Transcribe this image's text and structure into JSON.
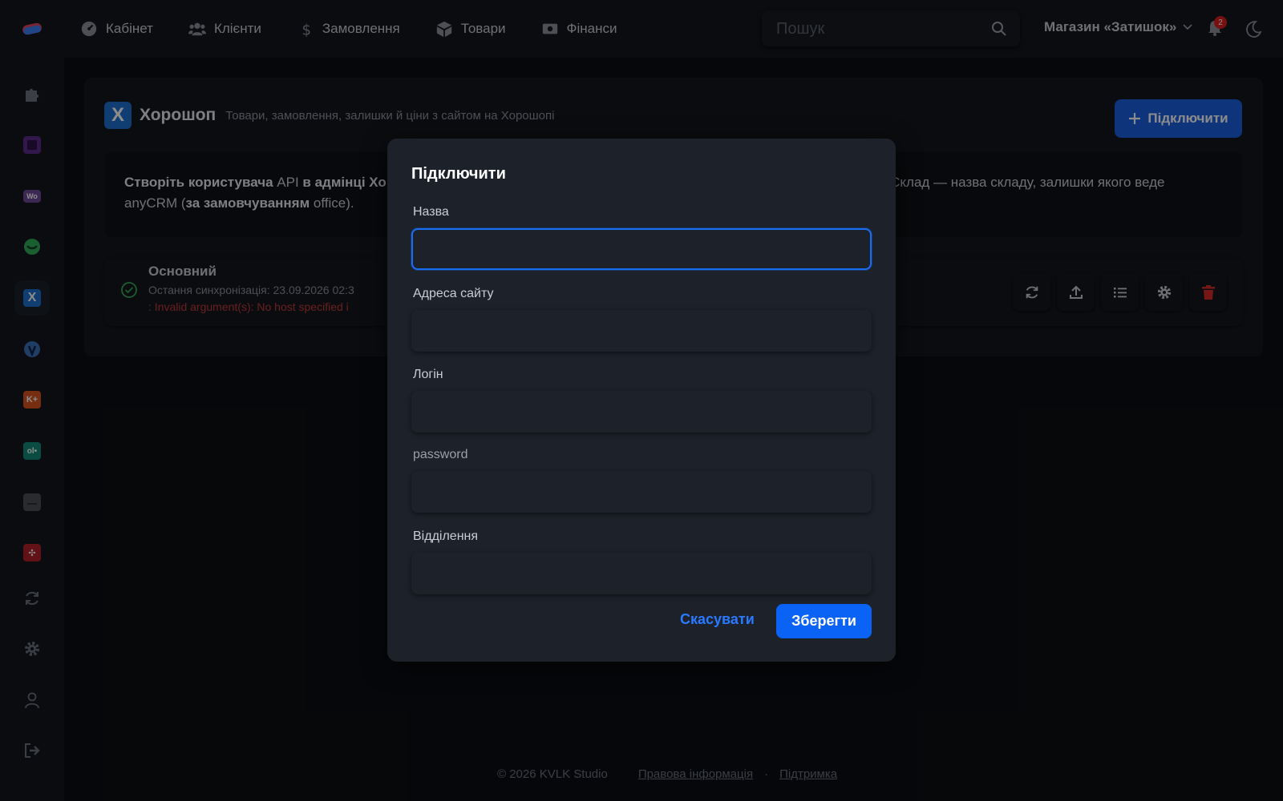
{
  "nav": {
    "items": [
      {
        "label": "Кабінет",
        "icon": "dashboard-icon"
      },
      {
        "label": "Клієнти",
        "icon": "users-icon"
      },
      {
        "label": "Замовлення",
        "icon": "dollar-icon"
      },
      {
        "label": "Товари",
        "icon": "box-icon"
      },
      {
        "label": "Фінанси",
        "icon": "money-icon"
      }
    ],
    "search_placeholder": "Пошук",
    "store_name": "Магазин «Затишок»",
    "notifications_count": "2"
  },
  "card": {
    "title": "Хорошоп",
    "logo_letter": "X",
    "subtitle": "Товари, замовлення, залишки й ціни з сайтом на Хорошопі",
    "connect_label": "Підключити",
    "info_part1": "Створіть користувача ",
    "info_api": "API",
    "info_part2": " в адмінці Хо",
    "info_part3": "ь. Склад — назва складу, залишки якого веде",
    "info_line2a": "anyCRM (",
    "info_line2b": "за замовчуванням",
    "info_line2c": " office)."
  },
  "connection": {
    "name": "Основний",
    "sync": "Остання синхронізація: 23.09.2026 02:3",
    "error": ": Invalid argument(s): No host specified i"
  },
  "modal": {
    "title": "Підключити",
    "fields": [
      {
        "label": "Назва",
        "value": ""
      },
      {
        "label": "Адреса сайту",
        "value": ""
      },
      {
        "label": "Логін",
        "value": ""
      },
      {
        "label": "password",
        "value": ""
      },
      {
        "label": "Відділення",
        "value": ""
      }
    ],
    "cancel_label": "Скасувати",
    "save_label": "Зберегти"
  },
  "footer": {
    "copyright": "© 2026 KVLK Studio",
    "legal": "Правова інформація",
    "separator": "·",
    "support": "Підтримка"
  },
  "colors": {
    "accent": "#0b63f6",
    "error": "#c33a3a",
    "success": "#2fae5a"
  }
}
